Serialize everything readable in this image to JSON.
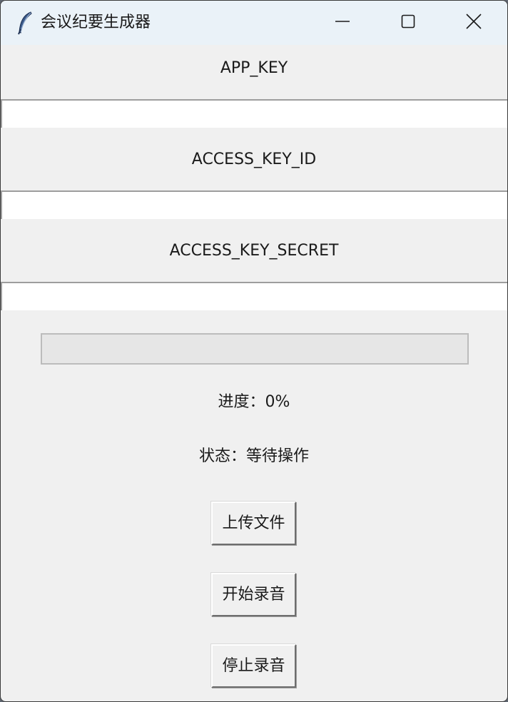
{
  "window": {
    "title": "会议纪要生成器",
    "app_icon": "feather-icon",
    "controls": [
      "minimize-icon",
      "maximize-icon",
      "close-icon"
    ]
  },
  "fields": [
    {
      "label": "APP_KEY",
      "value": ""
    },
    {
      "label": "ACCESS_KEY_ID",
      "value": ""
    },
    {
      "label": "ACCESS_KEY_SECRET",
      "value": ""
    }
  ],
  "progress": {
    "value": 0,
    "text": "进度：0%"
  },
  "status": {
    "text": "状态：等待操作"
  },
  "buttons": {
    "upload": "上传文件",
    "start_record": "开始录音",
    "stop_record": "停止录音"
  },
  "colors": {
    "titlebar": "#eaf2f8",
    "window_bg": "#f0f0f0",
    "progress_fill": "#06b025"
  }
}
